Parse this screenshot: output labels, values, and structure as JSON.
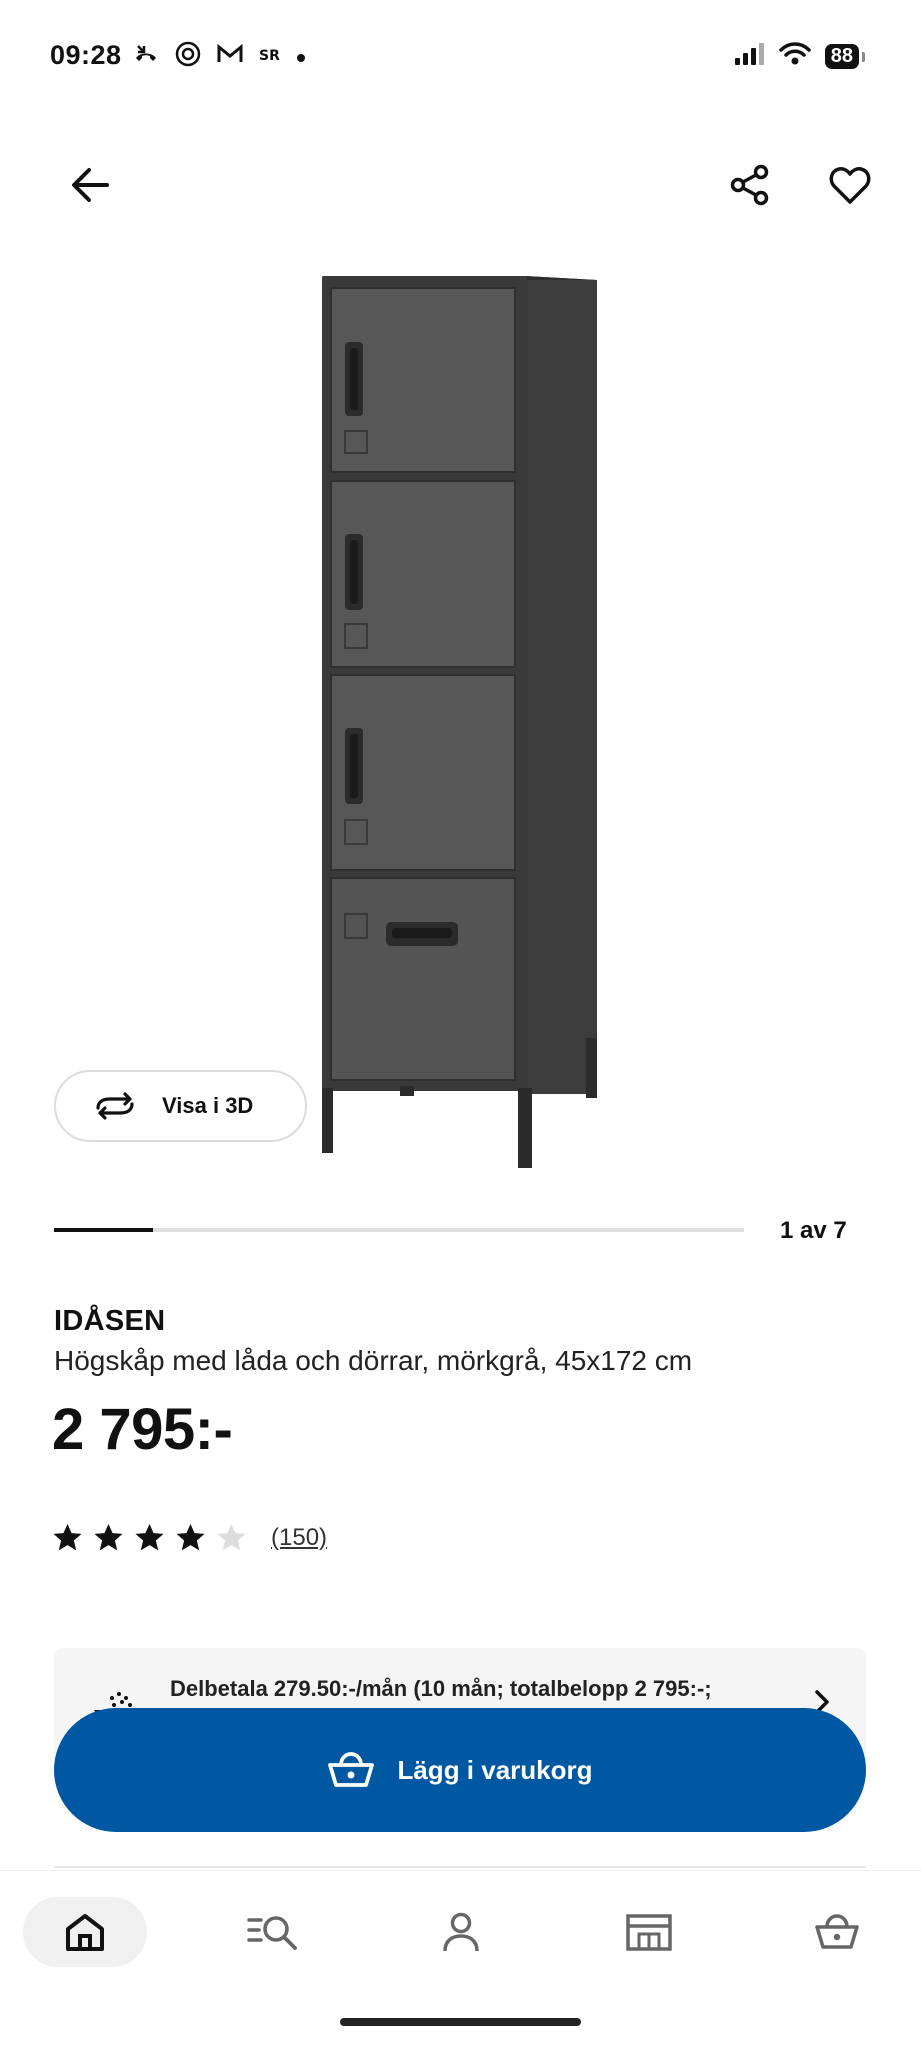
{
  "status_bar": {
    "time": "09:28",
    "battery": "88"
  },
  "product": {
    "brand": "IDÅSEN",
    "description": "Högskåp med låda och dörrar, mörkgrå, 45x172 cm",
    "price": "2 795:-",
    "rating_value": 4,
    "rating_max": 5,
    "review_count": "(150)"
  },
  "gallery": {
    "view_3d_label": "Visa i 3D",
    "page_indicator": "1 av 7",
    "progress_fraction": 0.143
  },
  "installment": {
    "text": "Delbetala 279.50:-/mån (10 mån; totalbelopp 2 795:-;"
  },
  "cart": {
    "add_label": "Lägg i varukorg"
  },
  "colors": {
    "primary_blue": "#0058a3",
    "text": "#111111",
    "star_filled": "#111111",
    "star_empty": "#dddddd"
  },
  "bottom_nav": {
    "items": [
      {
        "icon": "home-icon",
        "active": true
      },
      {
        "icon": "search-list-icon",
        "active": false
      },
      {
        "icon": "profile-icon",
        "active": false
      },
      {
        "icon": "store-icon",
        "active": false
      },
      {
        "icon": "cart-icon",
        "active": false
      }
    ]
  }
}
